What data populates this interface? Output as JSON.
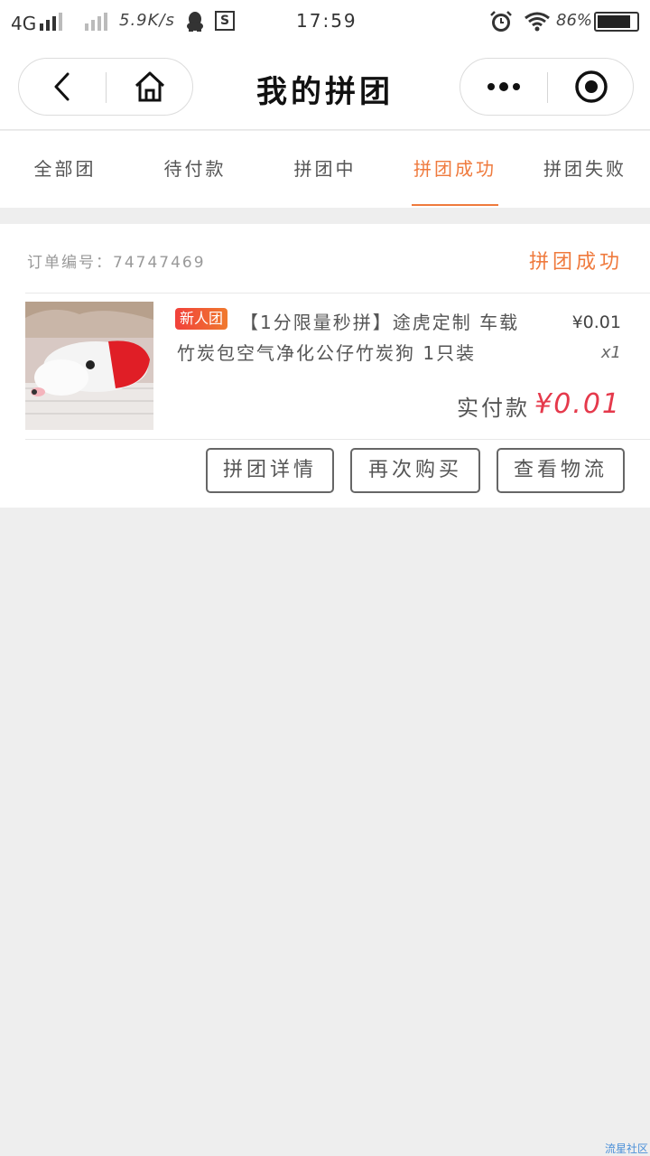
{
  "status_bar": {
    "network": "4G",
    "speed": "5.9K/s",
    "s_icon_letter": "S",
    "time": "17:59",
    "battery_percent": "86%",
    "battery_level": 0.86
  },
  "nav": {
    "title": "我的拼团"
  },
  "tabs": [
    {
      "label": "全部团"
    },
    {
      "label": "待付款"
    },
    {
      "label": "拼团中"
    },
    {
      "label": "拼团成功"
    },
    {
      "label": "拼团失败"
    }
  ],
  "active_tab": "拼团成功",
  "order": {
    "order_number": "订单编号：74747469",
    "status": "拼团成功",
    "tag": "新人团",
    "product_name": "【1分限量秒拼】途虎定制 车载竹炭包空气净化公仔竹炭狗 1只装",
    "unit_price": "¥0.01",
    "quantity": "x1",
    "paid_label": "实付款",
    "paid_value": "¥0.01",
    "buttons": {
      "group_detail": "拼团详情",
      "buy_again": "再次购买",
      "view_logistics": "查看物流"
    }
  },
  "watermark": "流星社区",
  "colors": {
    "accent": "#ef7a3d",
    "price": "#e5394b",
    "tag_start": "#f1413b",
    "tag_end": "#f0792e",
    "background": "#eeeeee"
  },
  "icons": [
    "back-icon",
    "home-icon",
    "more-icon",
    "target-icon",
    "qq-icon",
    "alarm-icon",
    "wifi-icon"
  ]
}
